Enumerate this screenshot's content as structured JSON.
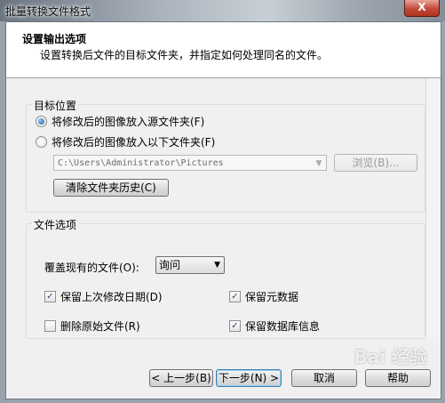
{
  "window": {
    "title": "批量转换文件格式",
    "close_glyph": "X"
  },
  "header": {
    "title": "设置输出选项",
    "subtitle": "设置转换后文件的目标文件夹，并指定如何处理同名的文件。"
  },
  "destination": {
    "group_label": "目标位置",
    "option_source": "将修改后的图像放入源文件夹(F)",
    "option_other": "将修改后的图像放入以下文件夹(F)",
    "selected": "source",
    "folder_path": "C:\\Users\\Administrator\\Pictures",
    "browse_label": "浏览(B)...",
    "clear_history_label": "清除文件夹历史(C)"
  },
  "file_options": {
    "group_label": "文件选项",
    "overwrite_label": "覆盖现有的文件(O):",
    "overwrite_value": "询问",
    "keep_date_label": "保留上次修改日期(D)",
    "keep_date_checked": true,
    "keep_metadata_label": "保留元数据",
    "keep_metadata_checked": true,
    "delete_original_label": "删除原始文件(R)",
    "delete_original_checked": false,
    "keep_db_label": "保留数据库信息",
    "keep_db_checked": true
  },
  "footer": {
    "back_label": "< 上一步(B)",
    "next_label": "下一步(N) >",
    "cancel_label": "取消",
    "help_label": "帮助"
  },
  "watermark": "Bai 经验"
}
